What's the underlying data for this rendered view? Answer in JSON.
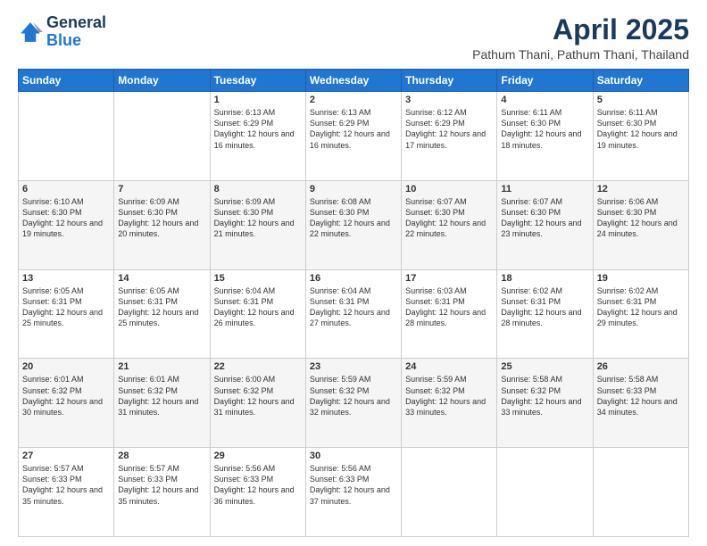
{
  "logo": {
    "line1": "General",
    "line2": "Blue"
  },
  "title": "April 2025",
  "subtitle": "Pathum Thani, Pathum Thani, Thailand",
  "weekdays": [
    "Sunday",
    "Monday",
    "Tuesday",
    "Wednesday",
    "Thursday",
    "Friday",
    "Saturday"
  ],
  "weeks": [
    [
      {
        "day": "",
        "sunrise": "",
        "sunset": "",
        "daylight": ""
      },
      {
        "day": "",
        "sunrise": "",
        "sunset": "",
        "daylight": ""
      },
      {
        "day": "1",
        "sunrise": "Sunrise: 6:13 AM",
        "sunset": "Sunset: 6:29 PM",
        "daylight": "Daylight: 12 hours and 16 minutes."
      },
      {
        "day": "2",
        "sunrise": "Sunrise: 6:13 AM",
        "sunset": "Sunset: 6:29 PM",
        "daylight": "Daylight: 12 hours and 16 minutes."
      },
      {
        "day": "3",
        "sunrise": "Sunrise: 6:12 AM",
        "sunset": "Sunset: 6:29 PM",
        "daylight": "Daylight: 12 hours and 17 minutes."
      },
      {
        "day": "4",
        "sunrise": "Sunrise: 6:11 AM",
        "sunset": "Sunset: 6:30 PM",
        "daylight": "Daylight: 12 hours and 18 minutes."
      },
      {
        "day": "5",
        "sunrise": "Sunrise: 6:11 AM",
        "sunset": "Sunset: 6:30 PM",
        "daylight": "Daylight: 12 hours and 19 minutes."
      }
    ],
    [
      {
        "day": "6",
        "sunrise": "Sunrise: 6:10 AM",
        "sunset": "Sunset: 6:30 PM",
        "daylight": "Daylight: 12 hours and 19 minutes."
      },
      {
        "day": "7",
        "sunrise": "Sunrise: 6:09 AM",
        "sunset": "Sunset: 6:30 PM",
        "daylight": "Daylight: 12 hours and 20 minutes."
      },
      {
        "day": "8",
        "sunrise": "Sunrise: 6:09 AM",
        "sunset": "Sunset: 6:30 PM",
        "daylight": "Daylight: 12 hours and 21 minutes."
      },
      {
        "day": "9",
        "sunrise": "Sunrise: 6:08 AM",
        "sunset": "Sunset: 6:30 PM",
        "daylight": "Daylight: 12 hours and 22 minutes."
      },
      {
        "day": "10",
        "sunrise": "Sunrise: 6:07 AM",
        "sunset": "Sunset: 6:30 PM",
        "daylight": "Daylight: 12 hours and 22 minutes."
      },
      {
        "day": "11",
        "sunrise": "Sunrise: 6:07 AM",
        "sunset": "Sunset: 6:30 PM",
        "daylight": "Daylight: 12 hours and 23 minutes."
      },
      {
        "day": "12",
        "sunrise": "Sunrise: 6:06 AM",
        "sunset": "Sunset: 6:30 PM",
        "daylight": "Daylight: 12 hours and 24 minutes."
      }
    ],
    [
      {
        "day": "13",
        "sunrise": "Sunrise: 6:05 AM",
        "sunset": "Sunset: 6:31 PM",
        "daylight": "Daylight: 12 hours and 25 minutes."
      },
      {
        "day": "14",
        "sunrise": "Sunrise: 6:05 AM",
        "sunset": "Sunset: 6:31 PM",
        "daylight": "Daylight: 12 hours and 25 minutes."
      },
      {
        "day": "15",
        "sunrise": "Sunrise: 6:04 AM",
        "sunset": "Sunset: 6:31 PM",
        "daylight": "Daylight: 12 hours and 26 minutes."
      },
      {
        "day": "16",
        "sunrise": "Sunrise: 6:04 AM",
        "sunset": "Sunset: 6:31 PM",
        "daylight": "Daylight: 12 hours and 27 minutes."
      },
      {
        "day": "17",
        "sunrise": "Sunrise: 6:03 AM",
        "sunset": "Sunset: 6:31 PM",
        "daylight": "Daylight: 12 hours and 28 minutes."
      },
      {
        "day": "18",
        "sunrise": "Sunrise: 6:02 AM",
        "sunset": "Sunset: 6:31 PM",
        "daylight": "Daylight: 12 hours and 28 minutes."
      },
      {
        "day": "19",
        "sunrise": "Sunrise: 6:02 AM",
        "sunset": "Sunset: 6:31 PM",
        "daylight": "Daylight: 12 hours and 29 minutes."
      }
    ],
    [
      {
        "day": "20",
        "sunrise": "Sunrise: 6:01 AM",
        "sunset": "Sunset: 6:32 PM",
        "daylight": "Daylight: 12 hours and 30 minutes."
      },
      {
        "day": "21",
        "sunrise": "Sunrise: 6:01 AM",
        "sunset": "Sunset: 6:32 PM",
        "daylight": "Daylight: 12 hours and 31 minutes."
      },
      {
        "day": "22",
        "sunrise": "Sunrise: 6:00 AM",
        "sunset": "Sunset: 6:32 PM",
        "daylight": "Daylight: 12 hours and 31 minutes."
      },
      {
        "day": "23",
        "sunrise": "Sunrise: 5:59 AM",
        "sunset": "Sunset: 6:32 PM",
        "daylight": "Daylight: 12 hours and 32 minutes."
      },
      {
        "day": "24",
        "sunrise": "Sunrise: 5:59 AM",
        "sunset": "Sunset: 6:32 PM",
        "daylight": "Daylight: 12 hours and 33 minutes."
      },
      {
        "day": "25",
        "sunrise": "Sunrise: 5:58 AM",
        "sunset": "Sunset: 6:32 PM",
        "daylight": "Daylight: 12 hours and 33 minutes."
      },
      {
        "day": "26",
        "sunrise": "Sunrise: 5:58 AM",
        "sunset": "Sunset: 6:33 PM",
        "daylight": "Daylight: 12 hours and 34 minutes."
      }
    ],
    [
      {
        "day": "27",
        "sunrise": "Sunrise: 5:57 AM",
        "sunset": "Sunset: 6:33 PM",
        "daylight": "Daylight: 12 hours and 35 minutes."
      },
      {
        "day": "28",
        "sunrise": "Sunrise: 5:57 AM",
        "sunset": "Sunset: 6:33 PM",
        "daylight": "Daylight: 12 hours and 35 minutes."
      },
      {
        "day": "29",
        "sunrise": "Sunrise: 5:56 AM",
        "sunset": "Sunset: 6:33 PM",
        "daylight": "Daylight: 12 hours and 36 minutes."
      },
      {
        "day": "30",
        "sunrise": "Sunrise: 5:56 AM",
        "sunset": "Sunset: 6:33 PM",
        "daylight": "Daylight: 12 hours and 37 minutes."
      },
      {
        "day": "",
        "sunrise": "",
        "sunset": "",
        "daylight": ""
      },
      {
        "day": "",
        "sunrise": "",
        "sunset": "",
        "daylight": ""
      },
      {
        "day": "",
        "sunrise": "",
        "sunset": "",
        "daylight": ""
      }
    ]
  ]
}
